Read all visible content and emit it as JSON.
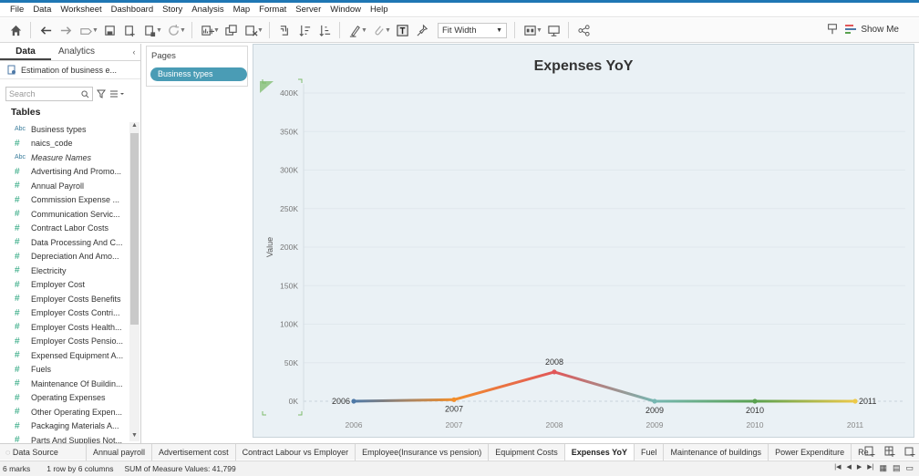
{
  "menu": [
    "File",
    "Data",
    "Worksheet",
    "Dashboard",
    "Story",
    "Analysis",
    "Map",
    "Format",
    "Server",
    "Window",
    "Help"
  ],
  "toolbar": {
    "fit_label": "Fit Width",
    "show_me": "Show Me"
  },
  "left_pane": {
    "tabs": [
      "Data",
      "Analytics"
    ],
    "datasource": "Estimation of business e...",
    "search_placeholder": "Search",
    "tables_heading": "Tables",
    "fields": [
      {
        "type": "Abc",
        "label": "Business types"
      },
      {
        "type": "#",
        "label": "naics_code"
      },
      {
        "type": "Abc",
        "label": "Measure Names",
        "italic": true
      },
      {
        "type": "#",
        "label": "Advertising And Promo..."
      },
      {
        "type": "#",
        "label": "Annual Payroll"
      },
      {
        "type": "#",
        "label": "Commission Expense ..."
      },
      {
        "type": "#",
        "label": "Communication Servic..."
      },
      {
        "type": "#",
        "label": "Contract Labor Costs"
      },
      {
        "type": "#",
        "label": "Data Processing And C..."
      },
      {
        "type": "#",
        "label": "Depreciation And Amo..."
      },
      {
        "type": "#",
        "label": "Electricity"
      },
      {
        "type": "#",
        "label": "Employer Cost"
      },
      {
        "type": "#",
        "label": "Employer Costs Benefits"
      },
      {
        "type": "#",
        "label": "Employer Costs Contri..."
      },
      {
        "type": "#",
        "label": "Employer Costs Health..."
      },
      {
        "type": "#",
        "label": "Employer Costs Pensio..."
      },
      {
        "type": "#",
        "label": "Expensed Equipment A..."
      },
      {
        "type": "#",
        "label": "Fuels"
      },
      {
        "type": "#",
        "label": "Maintenance Of Buildin..."
      },
      {
        "type": "#",
        "label": "Operating Expenses"
      },
      {
        "type": "#",
        "label": "Other Operating Expen..."
      },
      {
        "type": "#",
        "label": "Packaging Materials A..."
      },
      {
        "type": "#",
        "label": "Parts And Supplies Not..."
      }
    ]
  },
  "pages": {
    "title": "Pages",
    "pill": "Business types"
  },
  "chart_data": {
    "type": "line",
    "title": "Expenses YoY",
    "ylabel": "Value",
    "xlabel": "",
    "x": [
      "2006",
      "2007",
      "2008",
      "2009",
      "2010",
      "2011"
    ],
    "y": [
      0,
      2000,
      38000,
      0,
      0,
      0
    ],
    "point_labels": [
      "2006",
      "2007",
      "2008",
      "2009",
      "2010",
      "2011"
    ],
    "ylim": [
      0,
      400000
    ],
    "yticks": [
      "0K",
      "50K",
      "100K",
      "150K",
      "200K",
      "250K",
      "300K",
      "350K",
      "400K"
    ],
    "colors": [
      "#4e79a7",
      "#f28e2b",
      "#e15759",
      "#76b7b2",
      "#59a14f",
      "#edc948"
    ]
  },
  "sheet_tabs": [
    "Data Source",
    "Annual payroll",
    "Advertisement cost",
    "Contract Labour vs Employer",
    "Employee(Insurance vs pension)",
    "Equipment Costs",
    "Expenses YoY",
    "Fuel",
    "Maintenance of buildings",
    "Power Expenditure",
    "Re"
  ],
  "active_sheet": "Expenses YoY",
  "status": {
    "marks": "6 marks",
    "rows": "1 row by 6 columns",
    "sum": "SUM of Measure Values: 41,799"
  }
}
